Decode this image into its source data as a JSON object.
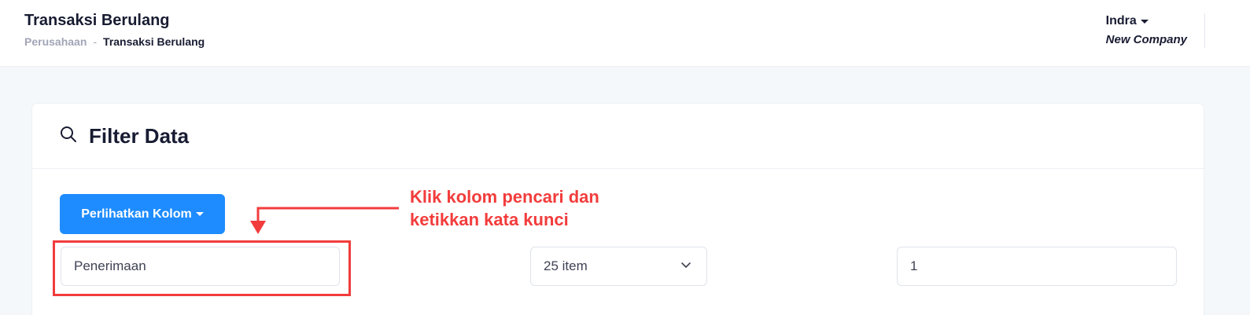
{
  "header": {
    "title": "Transaksi Berulang",
    "breadcrumb": {
      "parent": "Perusahaan",
      "separator": "-",
      "current": "Transaksi Berulang"
    },
    "user": {
      "name": "Indra",
      "company": "New Company"
    }
  },
  "filter_card": {
    "title": "Filter Data",
    "icon": "search-icon",
    "show_columns_label": "Perlihatkan Kolom",
    "search_value": "Penerimaan",
    "per_page_value": "25 item",
    "page_value": "1"
  },
  "annotation": {
    "text": "Klik kolom pencari dan\nketikkan kata kunci",
    "color": "#f23c3c"
  },
  "colors": {
    "accent": "#1e8cfe",
    "annotation": "#f23c3c"
  }
}
